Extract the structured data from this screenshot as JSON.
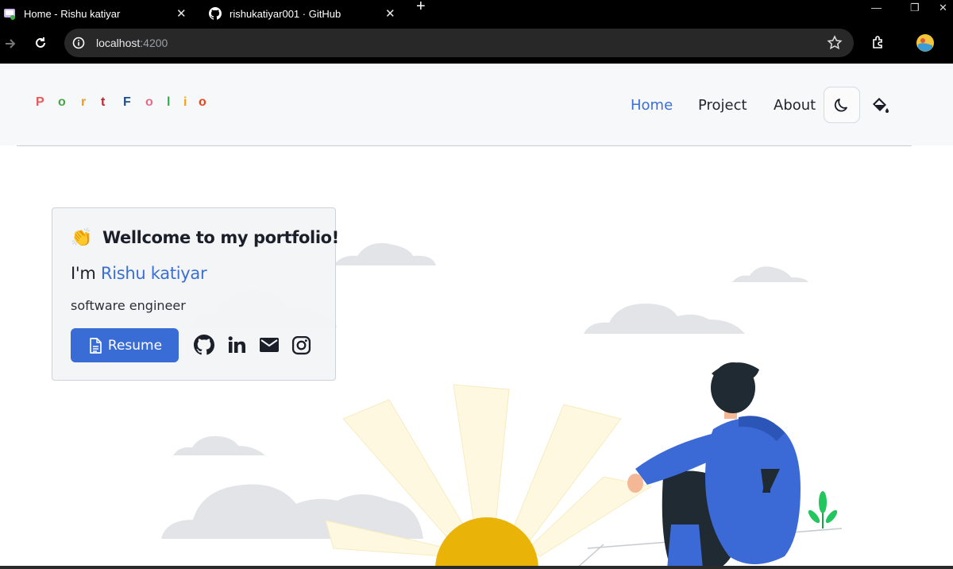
{
  "browser": {
    "tabs": [
      {
        "title": "Home - Rishu katiyar",
        "favicon": "portfolio-favicon"
      },
      {
        "title": "rishukatiyar001 · GitHub",
        "favicon": "github-icon"
      }
    ],
    "address": {
      "host": "localhost",
      "port": ":4200"
    }
  },
  "site": {
    "logo_letters": [
      "P",
      "o",
      "r",
      "t",
      "F",
      "o",
      "l",
      "i",
      "o"
    ],
    "logo_colors": [
      "#e8585a",
      "#44a743",
      "#f29b17",
      "#c0212d",
      "#1d4e89",
      "#e86a8a",
      "#2fae4e",
      "#f2a214",
      "#e8431a"
    ],
    "nav": [
      {
        "label": "Home",
        "active": true
      },
      {
        "label": "Project",
        "active": false
      },
      {
        "label": "About",
        "active": false
      }
    ],
    "accent": "#3b6fd4"
  },
  "hero": {
    "wave_emoji": "👏",
    "welcome": "Wellcome to my portfolio!",
    "intro_prefix": "I'm ",
    "name": "Rishu katiyar",
    "role": "software engineer",
    "resume_label": "Resume",
    "socials": [
      "github-icon",
      "linkedin-icon",
      "mail-icon",
      "instagram-icon"
    ]
  }
}
